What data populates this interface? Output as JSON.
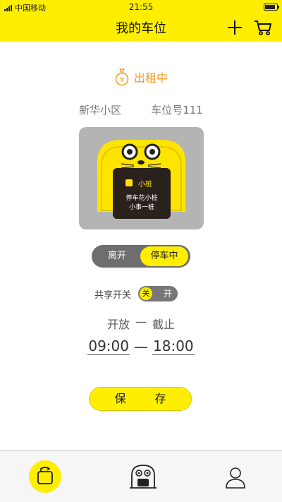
{
  "status_bar": {
    "carrier": "中国移动",
    "time": "21:55"
  },
  "header": {
    "title": "我的车位"
  },
  "parking": {
    "rent_status": "出租中",
    "community": "新华小区",
    "space_number": "车位号111",
    "device_brand": "小桩",
    "device_slogan_1": "停车花小桩",
    "device_slogan_2": "小事一桩"
  },
  "mode_toggle": {
    "leave_label": "离开",
    "parking_label": "停车中",
    "selected": "停车中"
  },
  "share": {
    "label": "共享开关",
    "off_label": "关",
    "on_label": "开",
    "state": "关"
  },
  "hours": {
    "open_label": "开放",
    "dash": "—",
    "close_label": "截止",
    "start": "09:00",
    "end": "18:00"
  },
  "actions": {
    "save_label": "保 存"
  },
  "colors": {
    "brand_yellow": "#ffee00",
    "status_orange": "#f39a1c",
    "toggle_gray": "#6e6e6e"
  },
  "tabbar": {
    "items": [
      "parking-space-icon",
      "mascot-icon",
      "profile-icon"
    ]
  }
}
